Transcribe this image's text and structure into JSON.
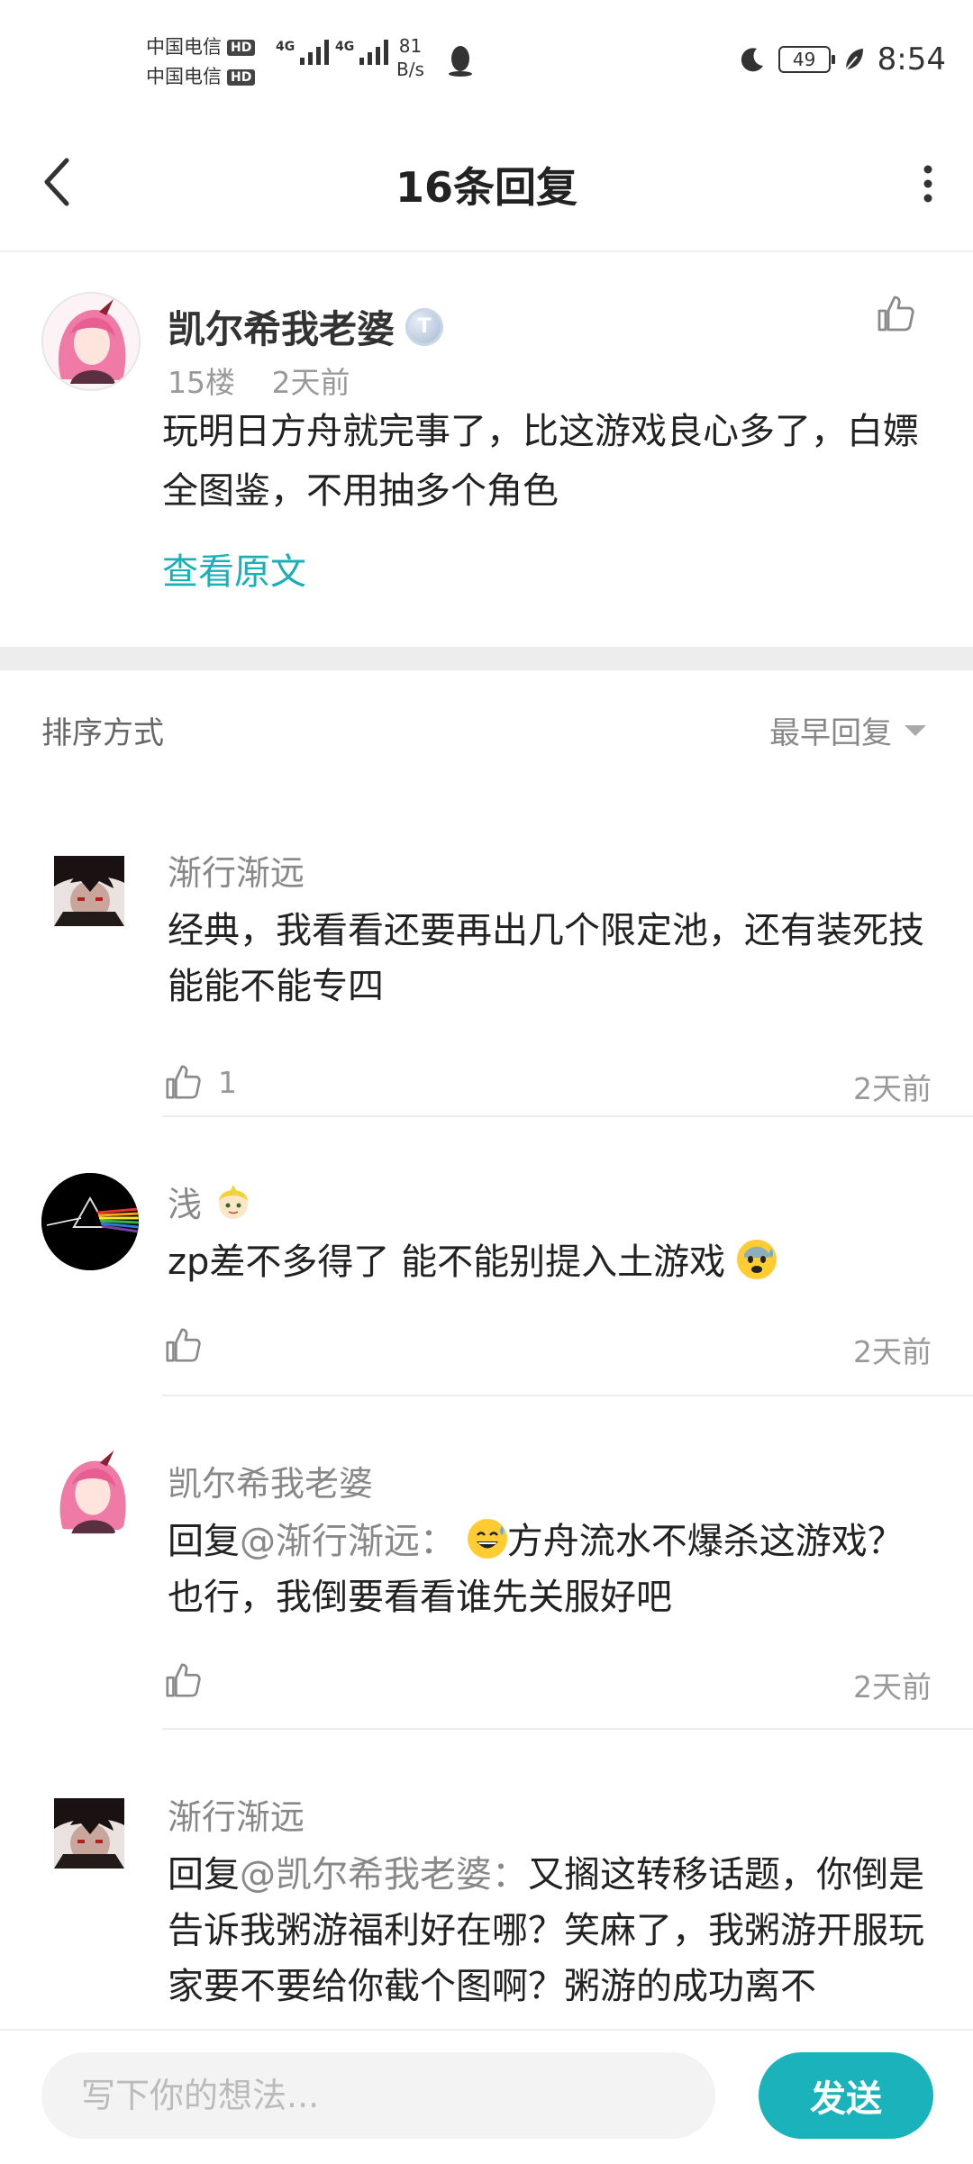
{
  "status_bar": {
    "carrier1": "中国电信",
    "carrier2": "中国电信",
    "hd": "HD",
    "net1": "4G",
    "net2": "4G",
    "speed_value": "81",
    "speed_unit": "B/s",
    "battery": "49",
    "time": "8:54"
  },
  "nav": {
    "title": "16条回复"
  },
  "post": {
    "author": "凯尔希我老婆",
    "level": "T",
    "floor": "15楼",
    "time": "2天前",
    "content": "玩明日方舟就完事了，比这游戏良心多了，白嫖全图鉴，不用抽多个角色",
    "view_original": "查看原文"
  },
  "sort": {
    "label": "排序方式",
    "selected": "最早回复"
  },
  "replies": [
    {
      "author": "渐行渐远",
      "content": "经典，我看看还要再出几个限定池，还有装死技能能不能专四",
      "likes": "1",
      "time": "2天前"
    },
    {
      "author": "浅",
      "content": "zp差不多得了 能不能别提入土游戏",
      "likes": "",
      "time": "2天前"
    },
    {
      "author": "凯尔希我老婆",
      "prefix": "回复",
      "mention": "@渐行渐远",
      "colon": "：",
      "content": "方舟流水不爆杀这游戏？也行，我倒要看看谁先关服好吧",
      "likes": "",
      "time": "2天前"
    },
    {
      "author": "渐行渐远",
      "prefix": "回复",
      "mention": "@凯尔希我老婆",
      "colon": "：",
      "content": "又搁这转移话题，你倒是告诉我粥游福利好在哪？笑麻了，我粥游开服玩家要不要给你截个图啊？粥游的成功离不",
      "likes": "",
      "time": ""
    }
  ],
  "composer": {
    "placeholder": "写下你的想法...",
    "send_label": "发送"
  },
  "colors": {
    "accent": "#1ab3bb",
    "link": "#1ab0b5",
    "muted": "#999999"
  }
}
